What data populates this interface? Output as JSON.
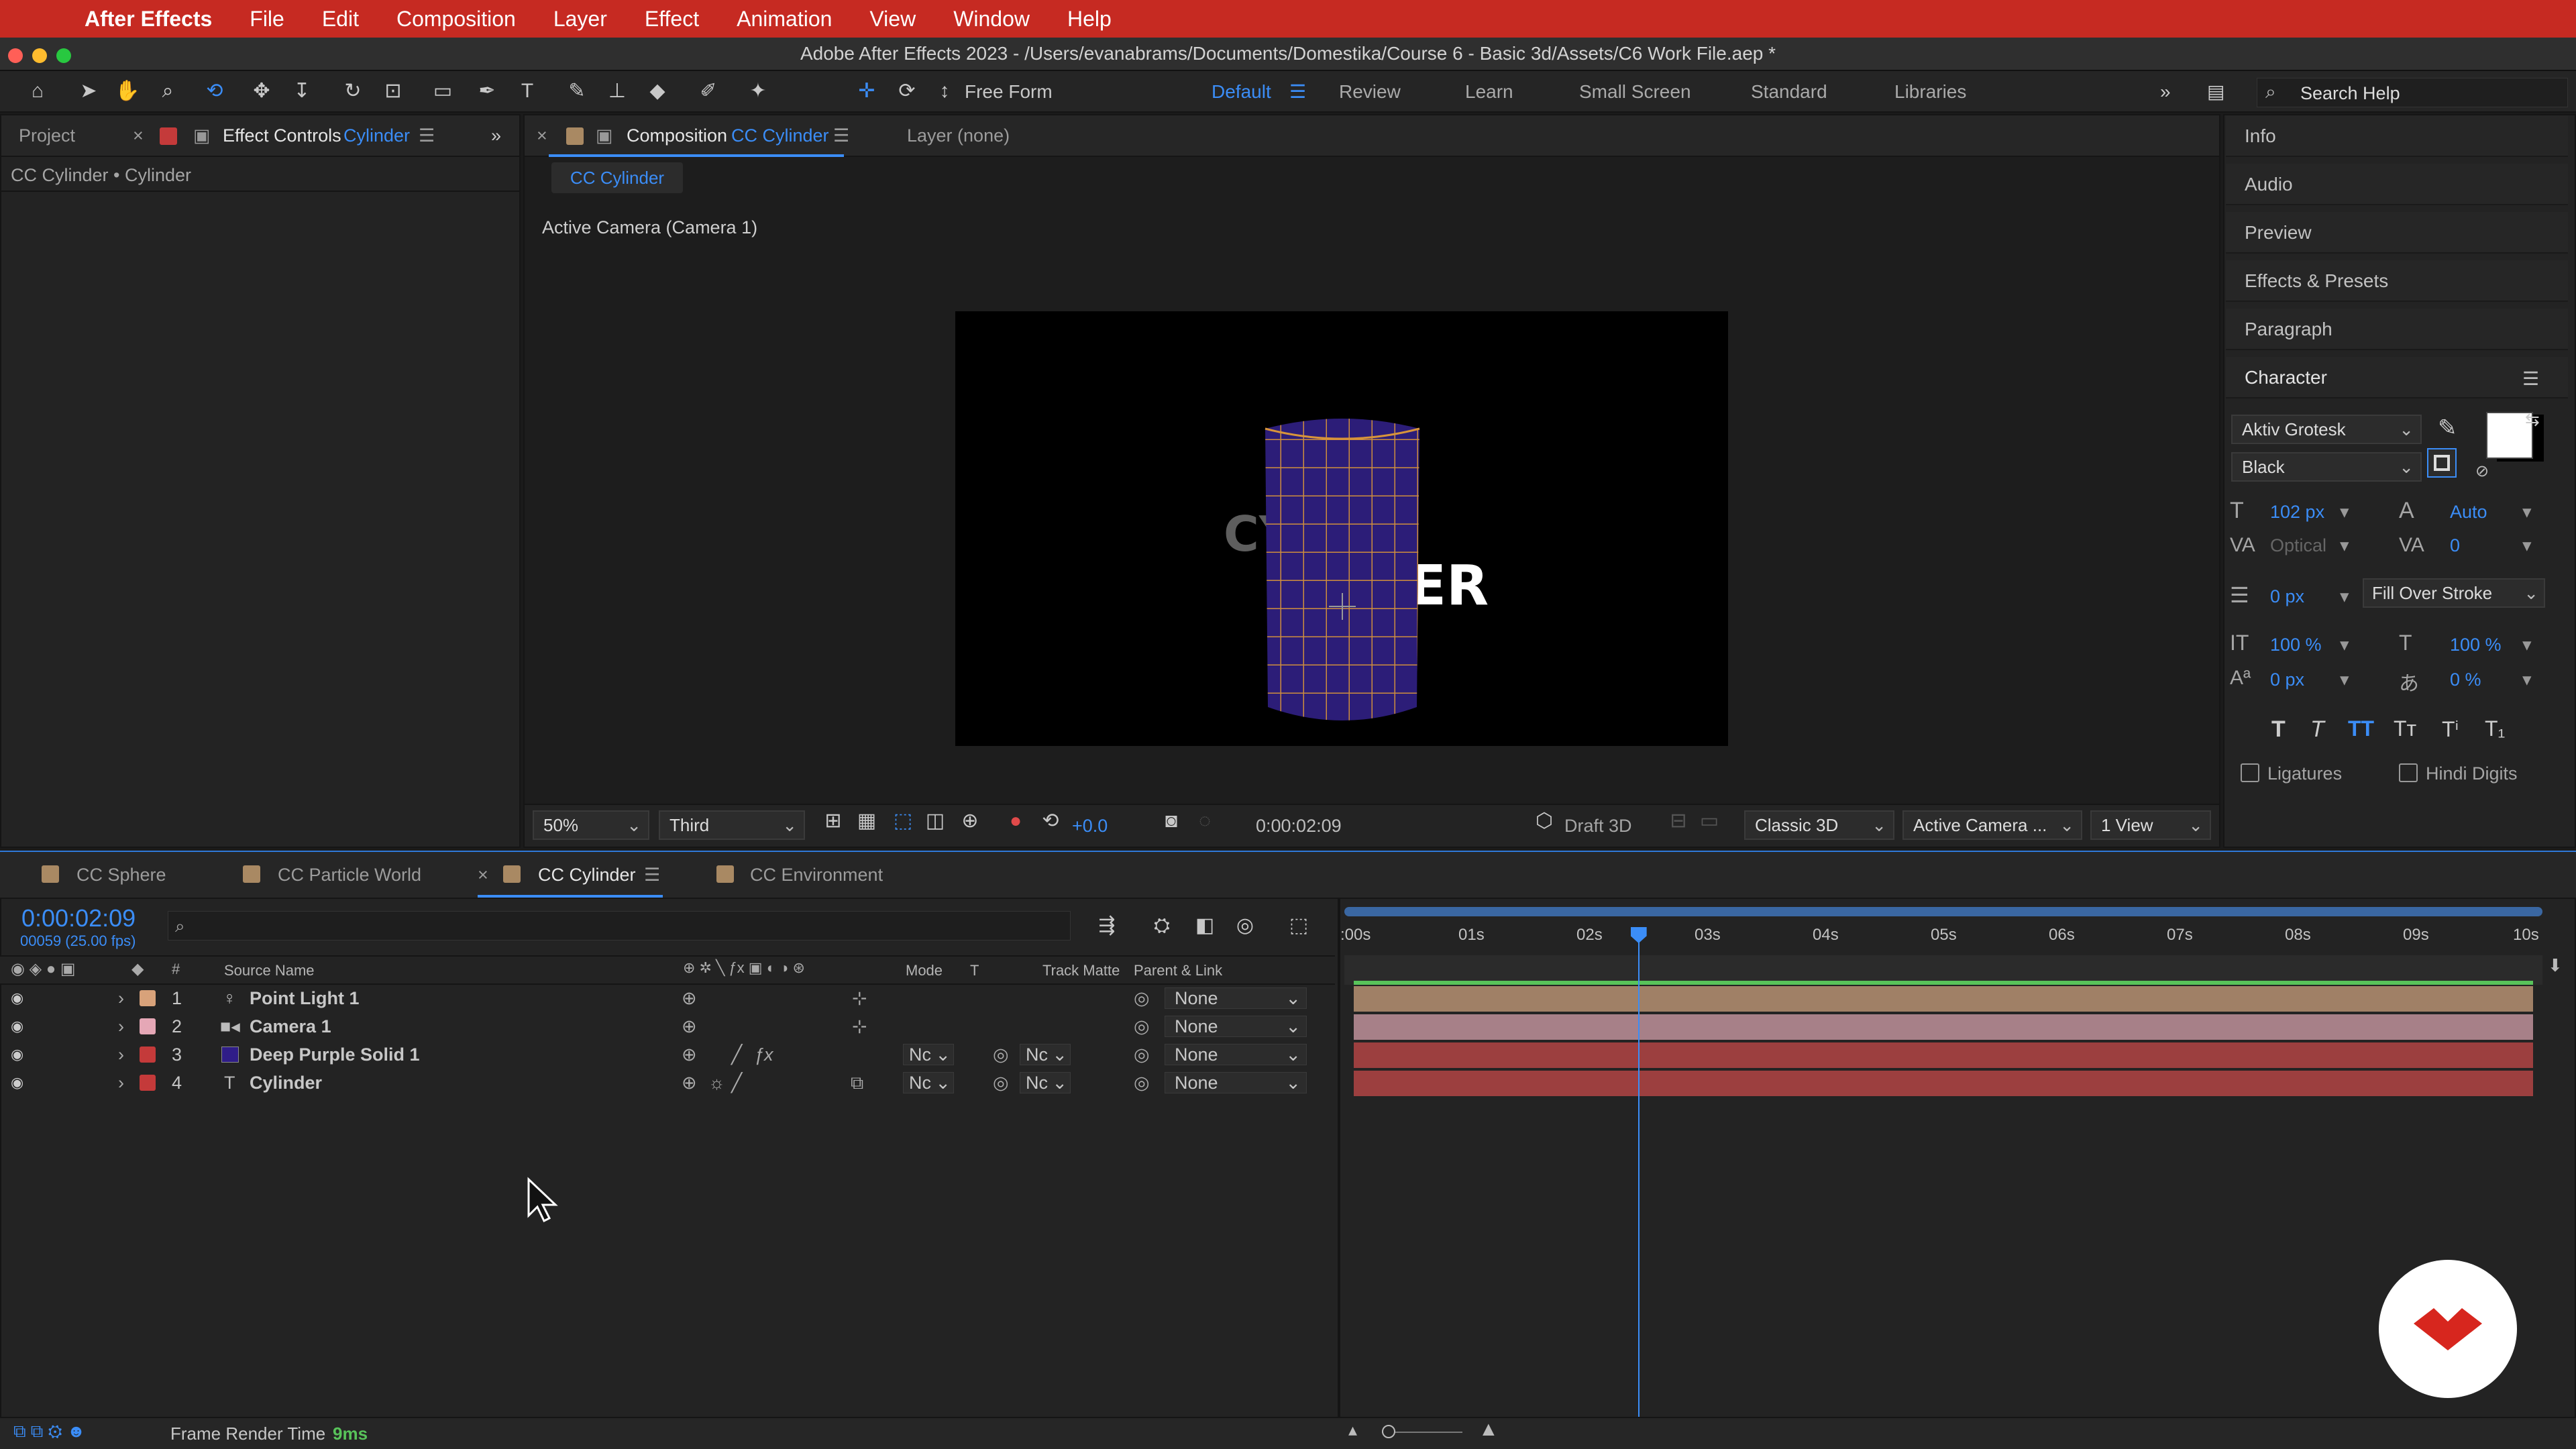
{
  "menubar": {
    "app": "After Effects",
    "items": [
      "File",
      "Edit",
      "Composition",
      "Layer",
      "Effect",
      "Animation",
      "View",
      "Window",
      "Help"
    ]
  },
  "window_title": "Adobe After Effects 2023 - /Users/evanabrams/Documents/Domestika/Course 6 - Basic 3d/Assets/C6 Work File.aep *",
  "toolbar": {
    "free_form": "Free Form",
    "workspaces": [
      "Default",
      "Review",
      "Learn",
      "Small Screen",
      "Standard",
      "Libraries"
    ],
    "search_placeholder": "Search Help"
  },
  "left_panel": {
    "tab_project": "Project",
    "tab_effect_controls": "Effect Controls",
    "effect_target": "Cylinder",
    "subtitle": "CC Cylinder • Cylinder"
  },
  "comp_panel": {
    "tab_label": "Composition",
    "comp_name": "CC Cylinder",
    "layer_tab": "Layer (none)",
    "sub_tab": "CC Cylinder",
    "camera_label": "Active Camera (Camera 1)",
    "zoom": "50%",
    "resolution": "Third",
    "exposure": "+0.0",
    "timecode": "0:00:02:09",
    "renderer_mode": "Draft 3D",
    "renderer": "Classic 3D",
    "view_camera": "Active Camera ...",
    "views": "1 View",
    "text_left": "CY",
    "text_right": "ER"
  },
  "right_panel": {
    "items": [
      "Info",
      "Audio",
      "Preview",
      "Effects & Presets",
      "Paragraph"
    ],
    "character_title": "Character",
    "font": "Aktiv Grotesk",
    "style": "Black",
    "size": "102 px",
    "leading": "Auto",
    "kerning": "Optical",
    "tracking": "0",
    "stroke_width": "0 px",
    "stroke_mode": "Fill Over Stroke",
    "vscale": "100 %",
    "hscale": "100 %",
    "baseline": "0 px",
    "tsume": "0 %",
    "ligatures": "Ligatures",
    "hindi_digits": "Hindi Digits",
    "fill_color": "#ffffff",
    "stroke_color": "#000000"
  },
  "timeline": {
    "tabs": [
      "CC Sphere",
      "CC Particle World",
      "CC Cylinder",
      "CC Environment"
    ],
    "tab_colors": [
      "#a98963",
      "#a98963",
      "#a98963",
      "#a98963"
    ],
    "timecode": "0:00:02:09",
    "frame_info": "00059 (25.00 fps)",
    "current_time_fraction": 0.241,
    "headers": {
      "num": "#",
      "source": "Source Name",
      "mode": "Mode",
      "t": "T",
      "matte": "Track Matte",
      "parent": "Parent & Link"
    },
    "layers": [
      {
        "num": "1",
        "name": "Point Light 1",
        "color": "#d8a27a",
        "mode": "",
        "matte": "",
        "parent": "None",
        "bar": "#a08066"
      },
      {
        "num": "2",
        "name": "Camera 1",
        "color": "#e5a7b6",
        "mode": "",
        "matte": "",
        "parent": "None",
        "bar": "#a78088"
      },
      {
        "num": "3",
        "name": "Deep Purple Solid 1",
        "color": "#c43a3a",
        "mode": "Nc",
        "matte": "Nc",
        "parent": "None",
        "bar": "#9c3f3f"
      },
      {
        "num": "4",
        "name": "Cylinder",
        "color": "#c43a3a",
        "mode": "Nc",
        "matte": "Nc",
        "parent": "None",
        "bar": "#9c3f3f"
      }
    ],
    "ruler": [
      ":00s",
      "01s",
      "02s",
      "03s",
      "04s",
      "05s",
      "06s",
      "07s",
      "08s",
      "09s",
      "10s"
    ],
    "frame_render_label": "Frame Render Time",
    "frame_render_value": "9ms"
  }
}
